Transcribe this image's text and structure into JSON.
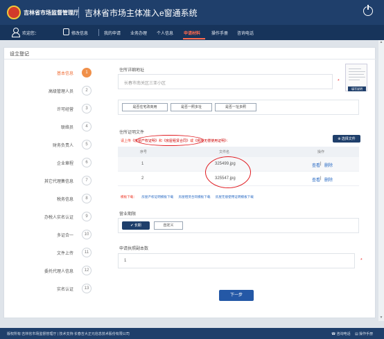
{
  "header": {
    "brand": "吉林省市场监督管理厅",
    "system_title": "吉林省市场主体准入e窗通系统"
  },
  "nav": {
    "welcome": "欢迎您：",
    "user_name": "",
    "edit_info": "修改信息",
    "items": [
      "我的申请",
      "业务办理",
      "个人信息",
      "申请材料",
      "操作手册",
      "咨询电话"
    ],
    "active_index": 3
  },
  "page": {
    "section_title": "设立登记",
    "steps": [
      {
        "label": "基本信息",
        "num": "1"
      },
      {
        "label": "高级管理人员",
        "num": "2"
      },
      {
        "label": "许可经营",
        "num": "3"
      },
      {
        "label": "联络员",
        "num": "4"
      },
      {
        "label": "财务负责人",
        "num": "5"
      },
      {
        "label": "企业章程",
        "num": "6"
      },
      {
        "label": "其它代理集信息",
        "num": "7"
      },
      {
        "label": "税务信息",
        "num": "8"
      },
      {
        "label": "办税人实名认证",
        "num": "9"
      },
      {
        "label": "多证合一",
        "num": "10"
      },
      {
        "label": "文件上传",
        "num": "11"
      },
      {
        "label": "委托代理人信息",
        "num": "12"
      },
      {
        "label": "实名认证",
        "num": "13"
      }
    ],
    "active_step": 0
  },
  "form": {
    "address_label": "住所详细地址",
    "address_value": "长春市南关区三亚小区",
    "required_mark": "*",
    "thumb_btn": "填写说明",
    "addr_buttons": [
      "是否住宅改商用",
      "是否一照多址",
      "是否一址多照"
    ],
    "doc_label": "住所证明文件",
    "upload_prefix": "请上传",
    "upload_doc1": "《房屋产权证明》",
    "upload_and": "和",
    "upload_doc2": "《房屋租赁合同》",
    "upload_or": "或",
    "upload_doc3": "《房屋无偿使用证明》",
    "upload_suffix": "：",
    "choose_file": "选择文件",
    "table": {
      "headers": [
        "序号",
        "文件名",
        "操作"
      ],
      "rows": [
        {
          "index": "1",
          "file": "325499.jpg",
          "view": "查看",
          "sep": "|",
          "delete": "删除"
        },
        {
          "index": "2",
          "file": "325547.jpg",
          "view": "查看",
          "sep": "|",
          "delete": "删除"
        }
      ]
    },
    "template_label": "模板下载：",
    "template_links": [
      "房屋产权证明模板下载",
      "房屋租赁合同模板下载",
      "房屋无偿使用证明模板下载"
    ],
    "period_label": "营业期限",
    "period_options": [
      "长期",
      "自定义"
    ],
    "period_check": "✔",
    "copies_label": "申请执照副本数",
    "copies_value": "1",
    "next_button": "下一步"
  },
  "footer": {
    "copyright": "版权所有:吉林省市场监督管理厅 | 技术支持:长春吉大正元信息技术股份有限公司",
    "hotline": "咨询电话",
    "manual": "操作手册"
  },
  "colors": {
    "header_bg": "#1f3f6b",
    "nav_bg": "#17345b",
    "accent_orange": "#f0904a",
    "active_nav": "#ff6a4d",
    "annotation_red": "#e0191f"
  }
}
